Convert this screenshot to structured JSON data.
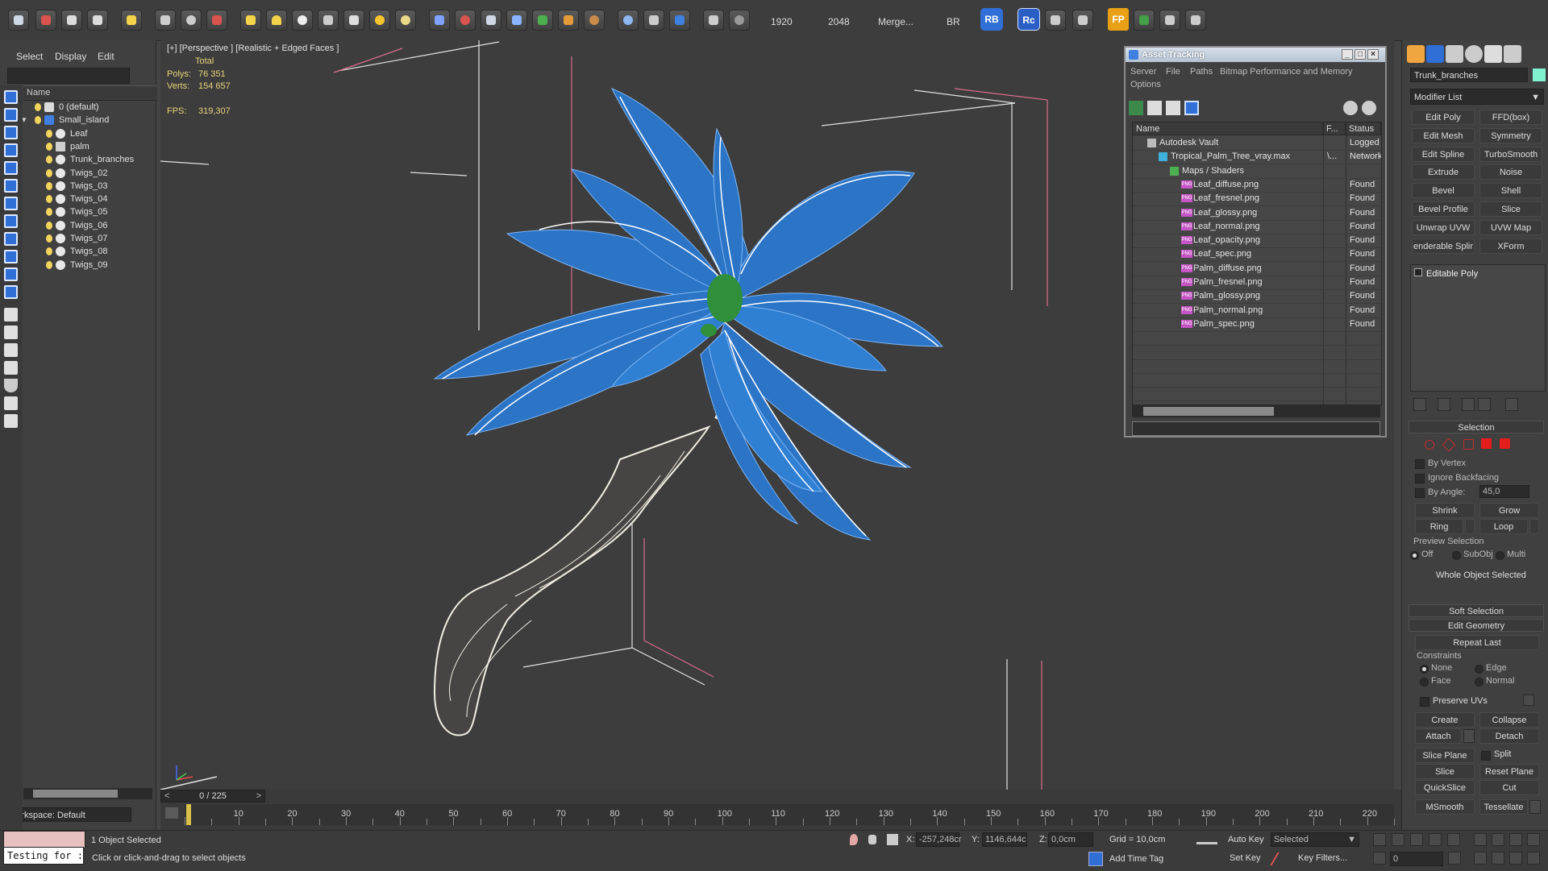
{
  "toolbar": {
    "render_width": "1920",
    "render_height": "2048",
    "merge_label": "Merge...",
    "br_label": "BR",
    "rb_label": "RB",
    "rc_label": "Rc",
    "fp_label": "FP"
  },
  "scene_explorer": {
    "menu": [
      "Select",
      "Display",
      "Edit"
    ],
    "column_name": "Name",
    "items": [
      {
        "label": "0 (default)",
        "indent": 0,
        "type": "layer"
      },
      {
        "label": "Small_island",
        "indent": 0,
        "type": "layer"
      },
      {
        "label": "Leaf",
        "indent": 1,
        "type": "object"
      },
      {
        "label": "palm",
        "indent": 1,
        "type": "group"
      },
      {
        "label": "Trunk_branches",
        "indent": 1,
        "type": "object"
      },
      {
        "label": "Twigs_02",
        "indent": 1,
        "type": "object"
      },
      {
        "label": "Twigs_03",
        "indent": 1,
        "type": "object"
      },
      {
        "label": "Twigs_04",
        "indent": 1,
        "type": "object"
      },
      {
        "label": "Twigs_05",
        "indent": 1,
        "type": "object"
      },
      {
        "label": "Twigs_06",
        "indent": 1,
        "type": "object"
      },
      {
        "label": "Twigs_07",
        "indent": 1,
        "type": "object"
      },
      {
        "label": "Twigs_08",
        "indent": 1,
        "type": "object"
      },
      {
        "label": "Twigs_09",
        "indent": 1,
        "type": "object"
      }
    ],
    "workspace": "Workspace: Default"
  },
  "viewport": {
    "label": "[+] [Perspective ] [Realistic + Edged Faces ]",
    "stats_total": "Total",
    "polys_label": "Polys:",
    "polys_value": "76 351",
    "verts_label": "Verts:",
    "verts_value": "154 657",
    "fps_label": "FPS:",
    "fps_value": "319,307"
  },
  "asset_tracking": {
    "title": "Asset Tracking",
    "menu": [
      "Server",
      "File",
      "Paths",
      "Bitmap Performance and Memory"
    ],
    "menu2": "Options",
    "columns": [
      "Name",
      "F...",
      "Status"
    ],
    "rows": [
      {
        "name": "Autodesk Vault",
        "full": "",
        "status": "Logged",
        "indent": 1,
        "kind": "vault"
      },
      {
        "name": "Tropical_Palm_Tree_vray.max",
        "full": "\\...",
        "status": "Network",
        "indent": 2,
        "kind": "max"
      },
      {
        "name": "Maps / Shaders",
        "full": "",
        "status": "",
        "indent": 3,
        "kind": "maps"
      },
      {
        "name": "Leaf_diffuse.png",
        "full": "",
        "status": "Found",
        "indent": 4,
        "kind": "png"
      },
      {
        "name": "Leaf_fresnel.png",
        "full": "",
        "status": "Found",
        "indent": 4,
        "kind": "png"
      },
      {
        "name": "Leaf_glossy.png",
        "full": "",
        "status": "Found",
        "indent": 4,
        "kind": "png"
      },
      {
        "name": "Leaf_normal.png",
        "full": "",
        "status": "Found",
        "indent": 4,
        "kind": "png"
      },
      {
        "name": "Leaf_opacity.png",
        "full": "",
        "status": "Found",
        "indent": 4,
        "kind": "png"
      },
      {
        "name": "Leaf_spec.png",
        "full": "",
        "status": "Found",
        "indent": 4,
        "kind": "png"
      },
      {
        "name": "Palm_diffuse.png",
        "full": "",
        "status": "Found",
        "indent": 4,
        "kind": "png"
      },
      {
        "name": "Palm_fresnel.png",
        "full": "",
        "status": "Found",
        "indent": 4,
        "kind": "png"
      },
      {
        "name": "Palm_glossy.png",
        "full": "",
        "status": "Found",
        "indent": 4,
        "kind": "png"
      },
      {
        "name": "Palm_normal.png",
        "full": "",
        "status": "Found",
        "indent": 4,
        "kind": "png"
      },
      {
        "name": "Palm_spec.png",
        "full": "",
        "status": "Found",
        "indent": 4,
        "kind": "png"
      }
    ],
    "png_badge": "PNG"
  },
  "command_panel": {
    "object_name": "Trunk_branches",
    "object_color": "#7ff2d0",
    "modifier_list": "Modifier List",
    "modifier_buttons": [
      "Edit Poly",
      "FFD(box)",
      "Edit Mesh",
      "Symmetry",
      "Edit Spline",
      "TurboSmooth",
      "Extrude",
      "Noise",
      "Bevel",
      "Shell",
      "Bevel Profile",
      "Slice",
      "Unwrap UVW",
      "UVW Map",
      "enderable Splir",
      "XForm"
    ],
    "stack_item": "Editable Poly",
    "selection": {
      "header": "Selection",
      "by_vertex": "By Vertex",
      "ignore_backfacing": "Ignore Backfacing",
      "by_angle": "By Angle:",
      "angle_value": "45,0",
      "shrink": "Shrink",
      "grow": "Grow",
      "ring": "Ring",
      "loop": "Loop",
      "preview_selection": "Preview Selection",
      "off": "Off",
      "subobj": "SubObj",
      "multi": "Multi",
      "whole_object": "Whole Object Selected"
    },
    "soft_selection": "Soft Selection",
    "edit_geometry": {
      "header": "Edit Geometry",
      "repeat_last": "Repeat Last",
      "constraints": "Constraints",
      "none": "None",
      "edge": "Edge",
      "face": "Face",
      "normal": "Normal",
      "preserve_uvs": "Preserve UVs",
      "create": "Create",
      "collapse": "Collapse",
      "attach": "Attach",
      "detach": "Detach",
      "slice_plane": "Slice Plane",
      "split": "Split",
      "slice": "Slice",
      "reset_plane": "Reset Plane",
      "quickslice": "QuickSlice",
      "cut": "Cut",
      "msmooth": "MSmooth",
      "tessellate": "Tessellate"
    }
  },
  "timeline": {
    "slider": "0 / 225",
    "ticks": [
      "10",
      "20",
      "30",
      "40",
      "50",
      "60",
      "70",
      "80",
      "90",
      "100",
      "110",
      "120",
      "130",
      "140",
      "150",
      "160",
      "170",
      "180",
      "190",
      "200",
      "210",
      "220"
    ]
  },
  "statusbar": {
    "script_text": "Testing for :",
    "selected_text": "1 Object Selected",
    "prompt": "Click or click-and-drag to select objects",
    "x_label": "X:",
    "x_value": "-257,248cr",
    "y_label": "Y:",
    "y_value": "1146,644c",
    "z_label": "Z:",
    "z_value": "0,0cm",
    "grid": "Grid = 10,0cm",
    "add_time_tag": "Add Time Tag",
    "auto_key": "Auto Key",
    "selected_dropdown": "Selected",
    "set_key": "Set Key",
    "key_filters": "Key Filters...",
    "frame_value": "0"
  }
}
